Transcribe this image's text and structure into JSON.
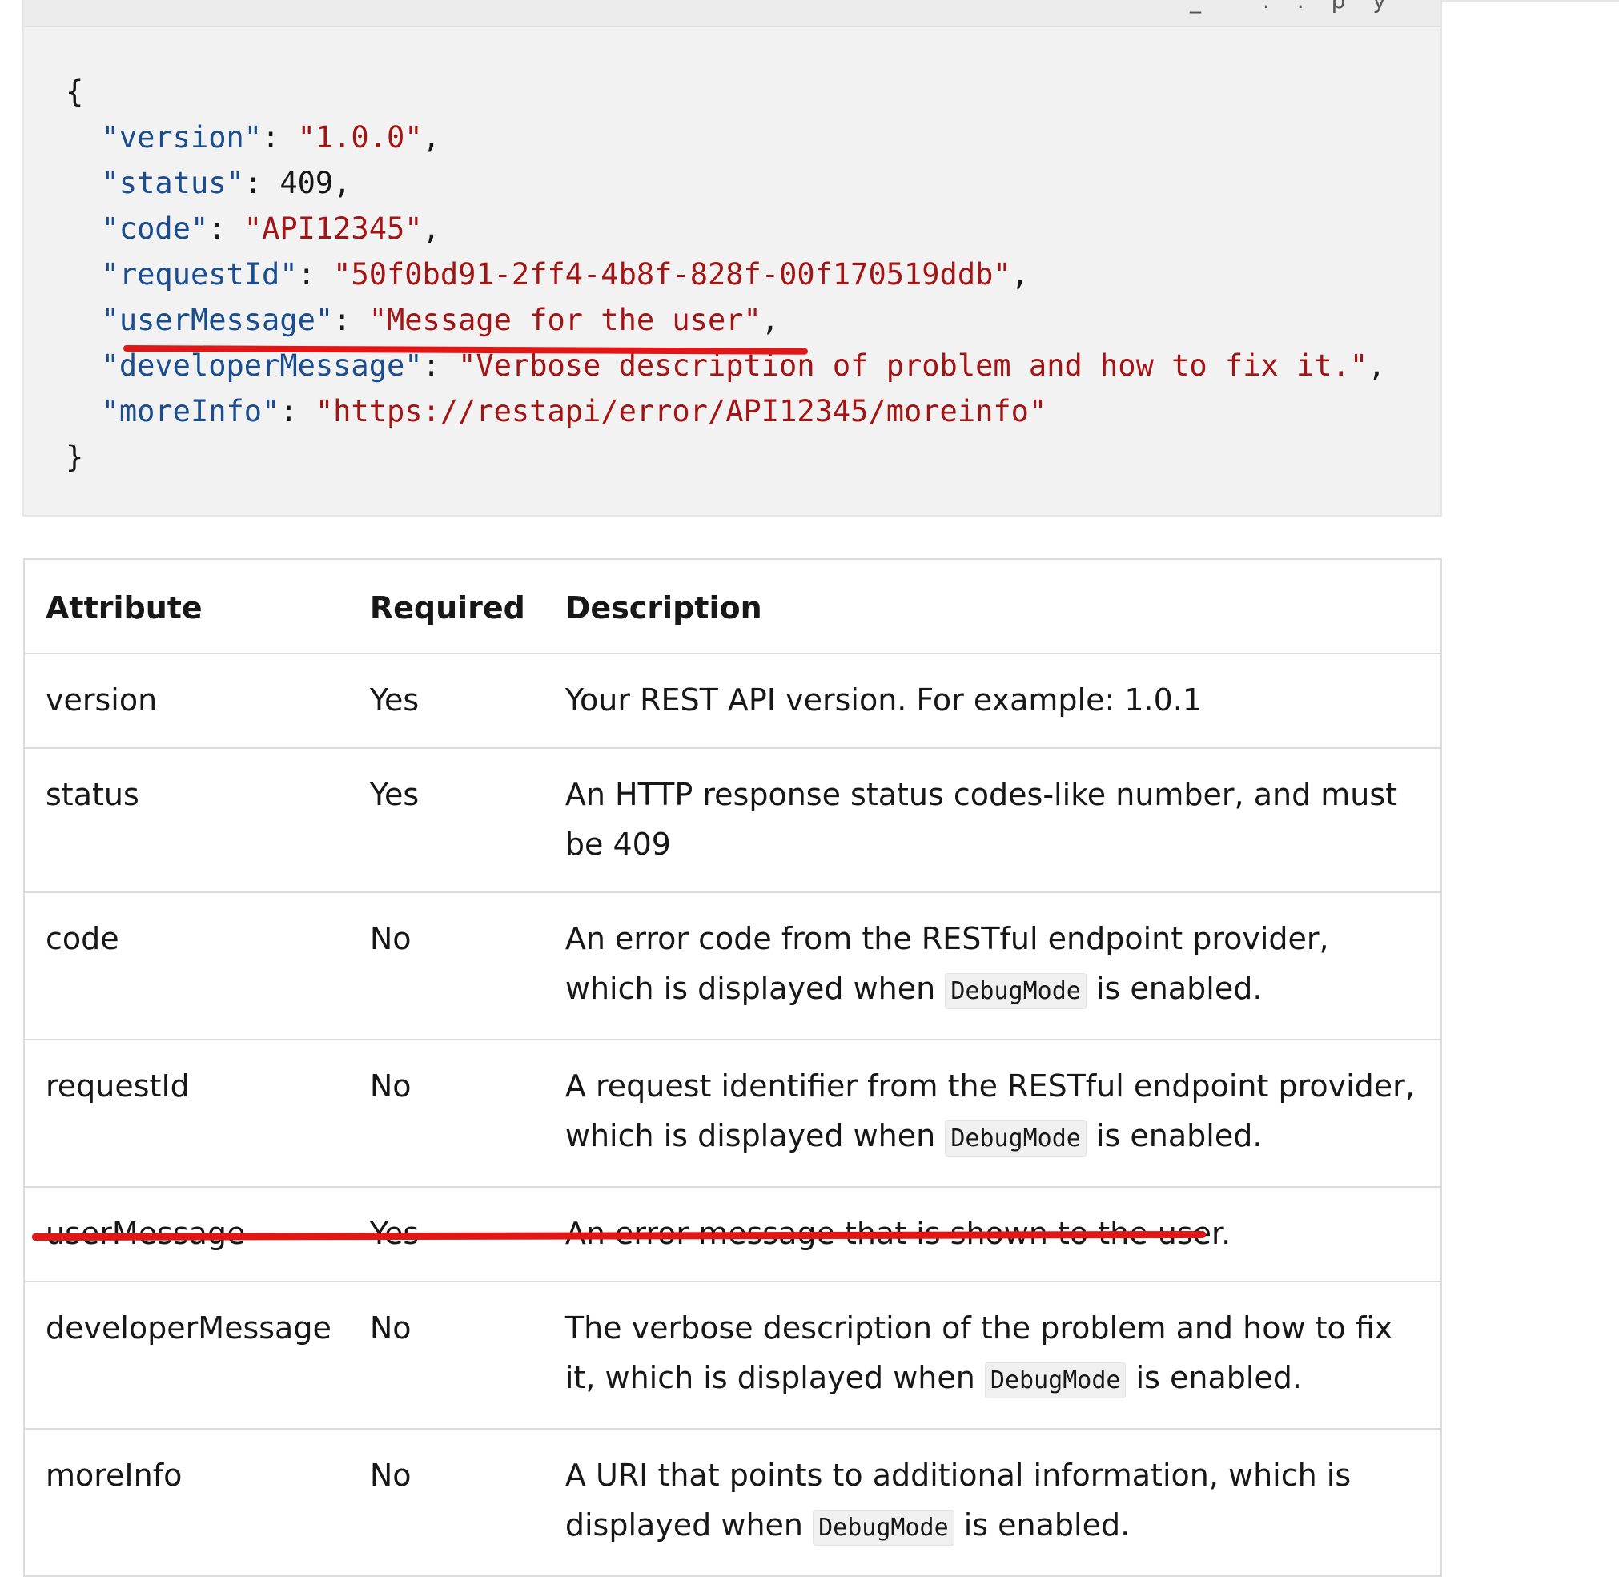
{
  "code_block": {
    "copy_label": "_ ..py",
    "lines": {
      "open": "{",
      "version_key": "\"version\"",
      "version_value": "\"1.0.0\"",
      "status_key": "\"status\"",
      "status_value": "409",
      "code_key": "\"code\"",
      "code_value": "\"API12345\"",
      "requestId_key": "\"requestId\"",
      "requestId_value": "\"50f0bd91-2ff4-4b8f-828f-00f170519ddb\"",
      "userMessage_key": "\"userMessage\"",
      "userMessage_value": "\"Message for the user\"",
      "developerMessage_key": "\"developerMessage\"",
      "developerMessage_value": "\"Verbose description of problem and how to fix it.\"",
      "moreInfo_key": "\"moreInfo\"",
      "moreInfo_value": "\"https://restapi/error/API12345/moreinfo\"",
      "close": "}"
    }
  },
  "table": {
    "headers": [
      "Attribute",
      "Required",
      "Description"
    ],
    "rows": [
      {
        "attribute": "version",
        "required": "Yes",
        "desc_pre": "Your REST API version. For example: 1.0.1",
        "code": "",
        "desc_post": ""
      },
      {
        "attribute": "status",
        "required": "Yes",
        "desc_pre": "An HTTP response status codes-like number, and must be 409",
        "code": "",
        "desc_post": ""
      },
      {
        "attribute": "code",
        "required": "No",
        "desc_pre": "An error code from the RESTful endpoint provider, which is displayed when ",
        "code": "DebugMode",
        "desc_post": " is enabled."
      },
      {
        "attribute": "requestId",
        "required": "No",
        "desc_pre": "A request identifier from the RESTful endpoint provider, which is displayed when ",
        "code": "DebugMode",
        "desc_post": " is enabled."
      },
      {
        "attribute": "userMessage",
        "required": "Yes",
        "desc_pre": "An error message that is shown to the user.",
        "code": "",
        "desc_post": ""
      },
      {
        "attribute": "developerMessage",
        "required": "No",
        "desc_pre": "The verbose description of the problem and how to fix it, which is displayed when ",
        "code": "DebugMode",
        "desc_post": " is enabled."
      },
      {
        "attribute": "moreInfo",
        "required": "No",
        "desc_pre": "A URI that points to additional information, which is displayed when ",
        "code": "DebugMode",
        "desc_post": " is enabled."
      }
    ]
  },
  "annotations": {
    "highlight_color": "#e11616"
  }
}
